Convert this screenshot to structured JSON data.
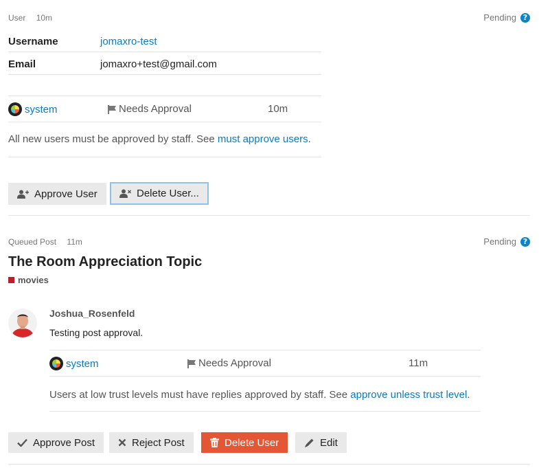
{
  "review1": {
    "type": "User",
    "age": "10m",
    "status": "Pending",
    "fields": [
      {
        "label": "Username",
        "value": "jomaxro-test"
      },
      {
        "label": "Email",
        "value": "jomaxro+test@gmail.com"
      }
    ],
    "score": {
      "user": "system",
      "reason": "Needs Approval",
      "time": "10m"
    },
    "explanation": {
      "text": "All new users must be approved by staff. See ",
      "link": "must approve users",
      "suffix": "."
    },
    "buttons": {
      "approve": "Approve User",
      "delete": "Delete User..."
    }
  },
  "review2": {
    "type": "Queued Post",
    "age": "11m",
    "status": "Pending",
    "topic_title": "The Room Appreciation Topic",
    "category": {
      "name": "movies",
      "color": "#bb1f2b"
    },
    "author": "Joshua_Rosenfeld",
    "body": "Testing post approval.",
    "score": {
      "user": "system",
      "reason": "Needs Approval",
      "time": "11m"
    },
    "explanation": {
      "text": "Users at low trust levels must have replies approved by staff. See ",
      "link": "approve unless trust level",
      "suffix": "."
    },
    "buttons": {
      "approve": "Approve Post",
      "reject": "Reject Post",
      "delete": "Delete User",
      "edit": "Edit"
    }
  },
  "colors": {
    "link": "#0a7bc4",
    "danger": "#e45735",
    "help": "#0a86c8",
    "focus_border": "#8fc1e3"
  }
}
